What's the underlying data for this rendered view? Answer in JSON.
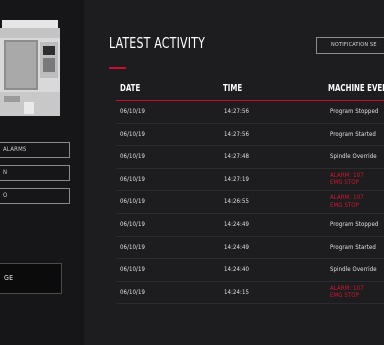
{
  "sidebar": {
    "buttons": [
      {
        "label": "ALARMS"
      },
      {
        "label": "N"
      },
      {
        "label": "O"
      }
    ],
    "big_button_label": "GE"
  },
  "activity": {
    "title": "LATEST ACTIVITY",
    "notification_button": "NOTIFICATION SE",
    "columns": [
      "DATE",
      "TIME",
      "MACHINE EVENT"
    ],
    "rows": [
      {
        "date": "06/10/19",
        "time": "14:27:56",
        "event": "Program Stopped",
        "alarm": false
      },
      {
        "date": "06/10/19",
        "time": "14:27:56",
        "event": "Program Started",
        "alarm": false
      },
      {
        "date": "06/10/19",
        "time": "14:27:48",
        "event": "Spindle Override",
        "alarm": false
      },
      {
        "date": "06/10/19",
        "time": "14:27:19",
        "event": "ALARM: 107 EMG STOP",
        "alarm": true
      },
      {
        "date": "06/10/19",
        "time": "14:26:55",
        "event": "ALARM: 107 EMG STOP",
        "alarm": true
      },
      {
        "date": "06/10/19",
        "time": "14:24:49",
        "event": "Program Stopped",
        "alarm": false
      },
      {
        "date": "06/10/19",
        "time": "14:24:49",
        "event": "Program Started",
        "alarm": false
      },
      {
        "date": "06/10/19",
        "time": "14:24:40",
        "event": "Spindle Override",
        "alarm": false
      },
      {
        "date": "06/10/19",
        "time": "14:24:15",
        "event": "ALARM: 107 EMG STOP",
        "alarm": true
      }
    ]
  },
  "colors": {
    "accent": "#c8102e",
    "background": "#1d1d20",
    "sidebar_bg": "#161618"
  },
  "icons": {
    "machine": "cnc-machine-image"
  }
}
